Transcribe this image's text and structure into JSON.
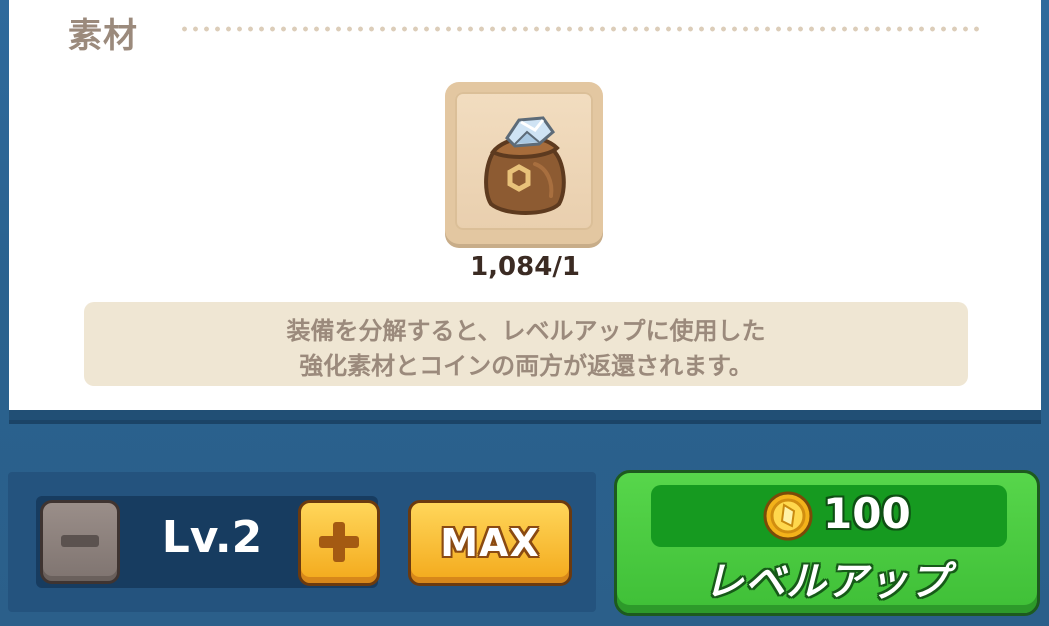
{
  "materials": {
    "section_title": "素材",
    "item": {
      "icon": "material-bag-icon",
      "count": "1,084/1"
    },
    "info": {
      "line1": "装備を分解すると、レベルアップに使用した",
      "line2": "強化素材とコインの両方が返還されます。"
    }
  },
  "level_control": {
    "level_label": "Lv.2",
    "max_label": "MAX",
    "minus_icon": "minus-icon",
    "plus_icon": "plus-icon"
  },
  "level_up": {
    "cost_icon": "coin-icon",
    "cost": "100",
    "label": "レベルアップ"
  },
  "colors": {
    "background": "#2f6a9c",
    "accent_green": "#3fbf37",
    "accent_yellow": "#f3a91b",
    "panel_text": "#9b8a7c"
  }
}
